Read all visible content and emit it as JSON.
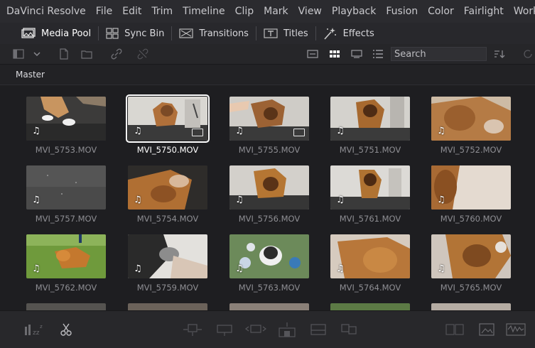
{
  "menu": [
    "DaVinci Resolve",
    "File",
    "Edit",
    "Trim",
    "Timeline",
    "Clip",
    "Mark",
    "View",
    "Playback",
    "Fusion",
    "Color",
    "Fairlight",
    "Worksp"
  ],
  "toolbar": {
    "media_pool": "Media Pool",
    "sync_bin": "Sync Bin",
    "transitions": "Transitions",
    "titles": "Titles",
    "effects": "Effects"
  },
  "search": {
    "placeholder": "Search"
  },
  "bin": {
    "name": "Master"
  },
  "clips": [
    {
      "name": "MVI_5753.MOV",
      "selected": false
    },
    {
      "name": "MVI_5750.MOV",
      "selected": true
    },
    {
      "name": "MVI_5755.MOV",
      "selected": false
    },
    {
      "name": "MVI_5751.MOV",
      "selected": false
    },
    {
      "name": "MVI_5752.MOV",
      "selected": false
    },
    {
      "name": "MVI_5757.MOV",
      "selected": false
    },
    {
      "name": "MVI_5754.MOV",
      "selected": false
    },
    {
      "name": "MVI_5756.MOV",
      "selected": false
    },
    {
      "name": "MVI_5761.MOV",
      "selected": false
    },
    {
      "name": "MVI_5760.MOV",
      "selected": false
    },
    {
      "name": "MVI_5762.MOV",
      "selected": false
    },
    {
      "name": "MVI_5759.MOV",
      "selected": false
    },
    {
      "name": "MVI_5763.MOV",
      "selected": false
    },
    {
      "name": "MVI_5764.MOV",
      "selected": false
    },
    {
      "name": "MVI_5765.MOV",
      "selected": false
    }
  ],
  "clip_icon": "music-note-icon",
  "colors": {
    "background": "#1e1e21",
    "selected_border": "#ffffff",
    "label": "#8e8e93"
  }
}
